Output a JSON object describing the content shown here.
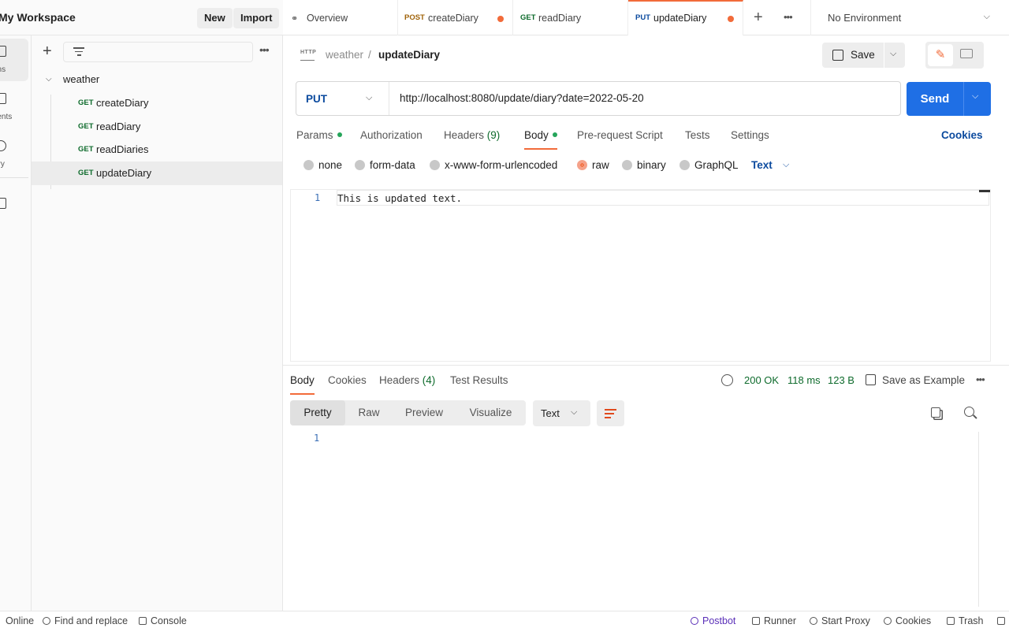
{
  "workspace": {
    "title": "My Workspace",
    "new_label": "New",
    "import_label": "Import"
  },
  "rail": [
    {
      "label": "Collections",
      "visible": "tions",
      "icon": "collections-icon"
    },
    {
      "label": "Environments",
      "visible": "ments",
      "icon": "environments-icon"
    },
    {
      "label": "History",
      "visible": "ory",
      "icon": "history-icon"
    },
    {
      "label": "",
      "visible": "",
      "icon": "flows-icon"
    }
  ],
  "sidebar": {
    "more_label": "•••",
    "folder": "weather",
    "requests": [
      {
        "method": "GET",
        "name": "createDiary"
      },
      {
        "method": "GET",
        "name": "readDiary"
      },
      {
        "method": "GET",
        "name": "readDiaries"
      },
      {
        "method": "GET",
        "name": "updateDiary",
        "selected": true
      }
    ]
  },
  "tabs": [
    {
      "method": "",
      "name": "Overview",
      "icon": "overview-icon"
    },
    {
      "method": "POST",
      "name": "createDiary",
      "unsaved": true,
      "method_color": "#a0630a"
    },
    {
      "method": "GET",
      "name": "readDiary",
      "method_color": "#0e6b2c"
    },
    {
      "method": "PUT",
      "name": "updateDiary",
      "unsaved": true,
      "active": true,
      "method_color": "#0b4a9e"
    }
  ],
  "tab_more_label": "•••",
  "environment": {
    "selected": "No Environment"
  },
  "request": {
    "breadcrumb_parent": "weather",
    "breadcrumb_sep": "/",
    "breadcrumb_current": "updateDiary",
    "save_label": "Save",
    "method": "PUT",
    "url": "http://localhost:8080/update/diary?date=2022-05-20",
    "send_label": "Send"
  },
  "request_tabs": {
    "params": "Params",
    "authorization": "Authorization",
    "headers": "Headers",
    "headers_count": "(9)",
    "body": "Body",
    "prerequest": "Pre-request Script",
    "tests": "Tests",
    "settings": "Settings",
    "cookies": "Cookies"
  },
  "body_types": {
    "none": "none",
    "form_data": "form-data",
    "urlencoded": "x-www-form-urlencoded",
    "raw": "raw",
    "binary": "binary",
    "graphql": "GraphQL",
    "content_type": "Text",
    "selected": "raw"
  },
  "editor": {
    "line_number": "1",
    "content": "This is updated text."
  },
  "response": {
    "tabs": {
      "body": "Body",
      "cookies": "Cookies",
      "headers": "Headers",
      "headers_count": "(4)",
      "test_results": "Test Results"
    },
    "status": "200 OK",
    "time": "118 ms",
    "size": "123 B",
    "save_example": "Save as Example",
    "more_label": "•••",
    "formats": {
      "pretty": "Pretty",
      "raw": "Raw",
      "preview": "Preview",
      "visualize": "Visualize"
    },
    "content_type": "Text",
    "line_number": "1"
  },
  "statusbar": {
    "online": "Online",
    "find_replace": "Find and replace",
    "console": "Console",
    "postbot": "Postbot",
    "runner": "Runner",
    "start_proxy": "Start Proxy",
    "cookies": "Cookies",
    "trash": "Trash"
  },
  "colors": {
    "accent": "#f26b3a",
    "send": "#1f6fe5",
    "link": "#0b4a9e",
    "success": "#0e6b2c"
  }
}
